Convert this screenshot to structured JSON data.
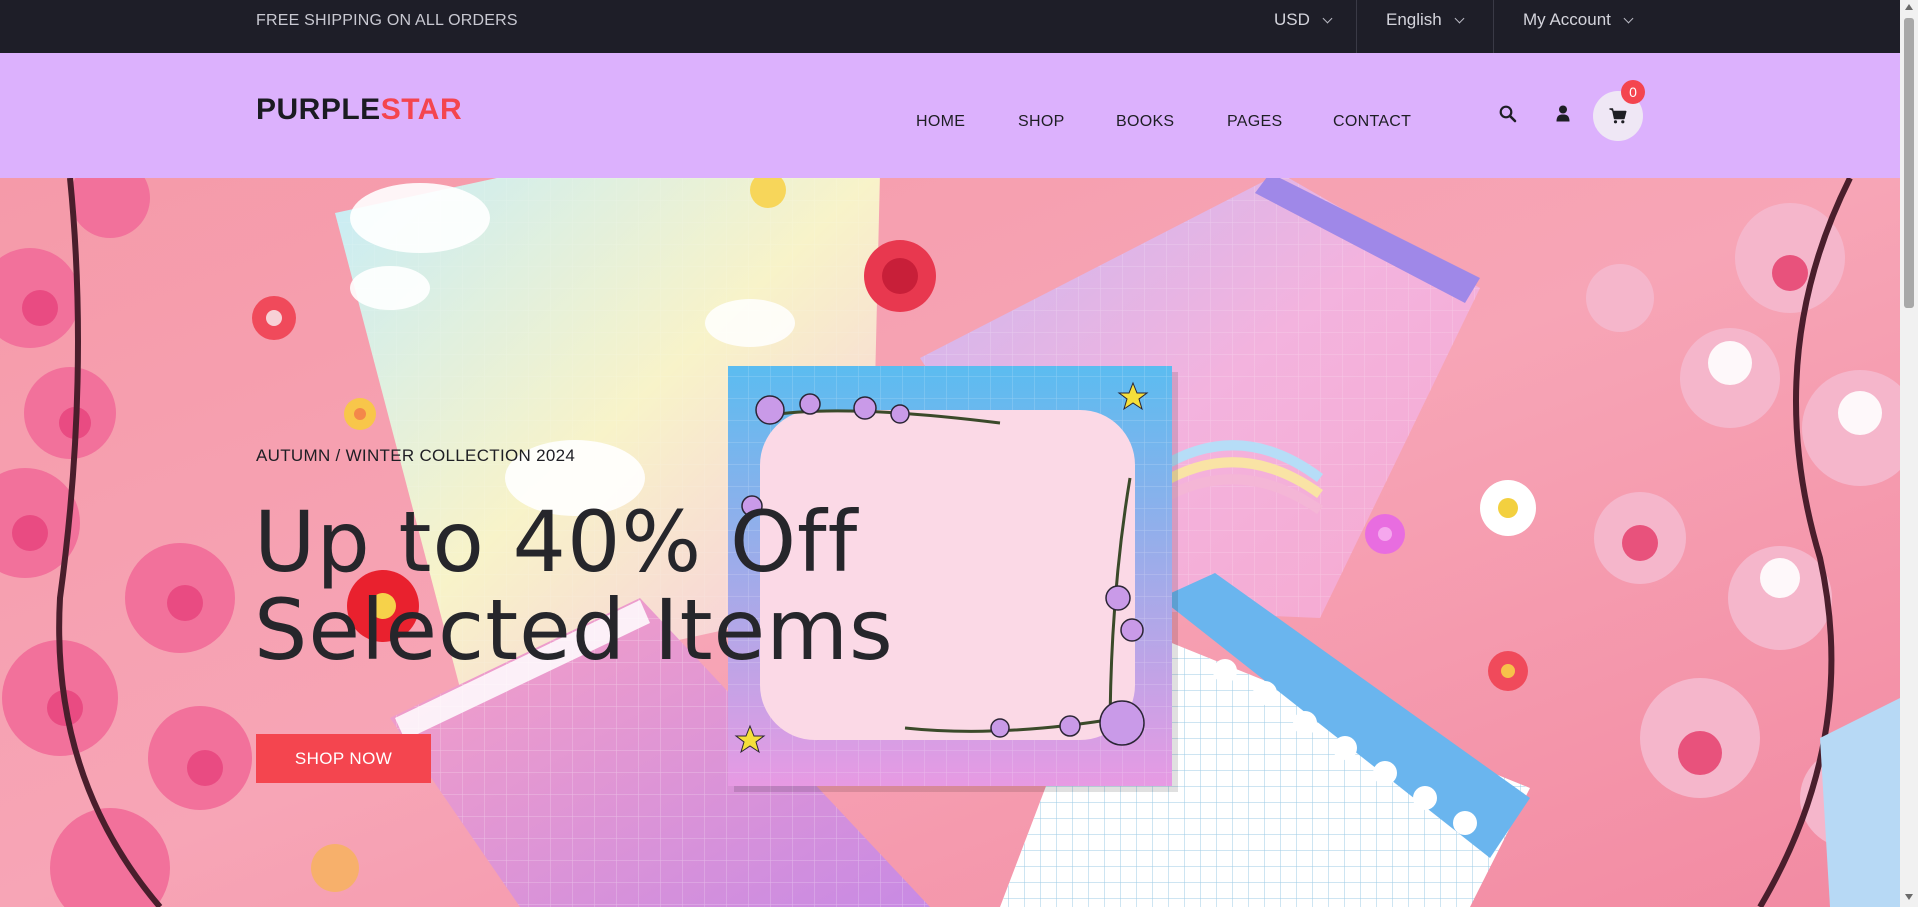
{
  "topbar": {
    "shipping_text": "FREE SHIPPING ON ALL ORDERS",
    "currency": "USD",
    "language": "English",
    "account": "My Account"
  },
  "header": {
    "logo_part1": "PURPLE",
    "logo_part2": "STAR",
    "nav": [
      "HOME",
      "SHOP",
      "BOOKS",
      "PAGES",
      "CONTACT"
    ],
    "cart_count": "0",
    "icons": [
      "search-icon",
      "user-icon",
      "cart-icon"
    ]
  },
  "hero": {
    "subtitle": "AUTUMN / WINTER COLLECTION 2024",
    "headline_line1": "Up to 40% Off",
    "headline_line2": "Selected Items",
    "cta": "SHOP NOW"
  },
  "colors": {
    "topbar_bg": "#1e1e28",
    "header_bg": "#dcb1fd",
    "accent": "#f4454f",
    "text_dark": "#1e1e24"
  }
}
